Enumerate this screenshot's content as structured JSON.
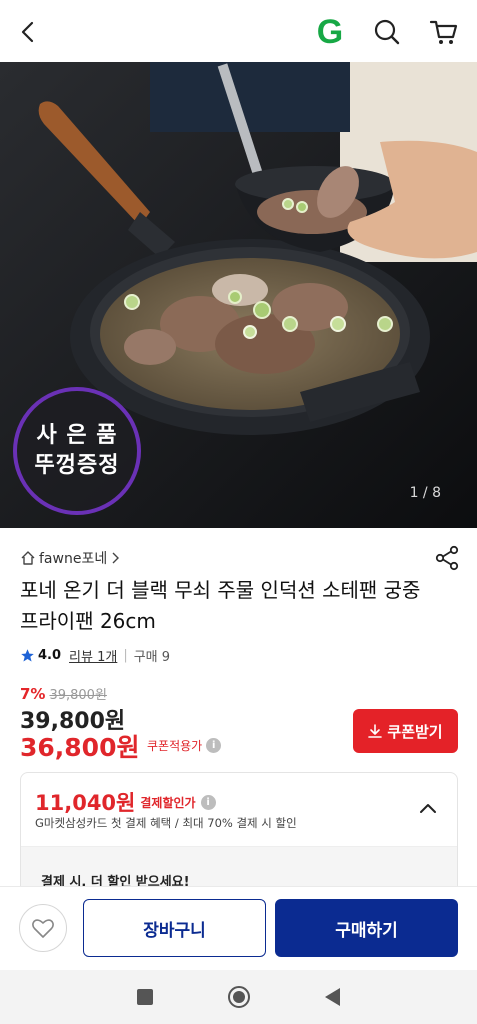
{
  "header": {
    "icons": [
      "back-arrow-icon",
      "gmarket-g-logo",
      "search-icon",
      "cart-icon"
    ],
    "logo_letter": "G",
    "logo_color": "#17a845"
  },
  "hero": {
    "badge_line1": "사 은 품",
    "badge_line2": "뚜껑증정",
    "badge_border_color": "#6a31b6",
    "pager": "1 / 8"
  },
  "product": {
    "brand": "fawne포네",
    "title": "포네 온기 더 블랙 무쇠 주물 인덕션 소테팬 궁중 프라이팬 26cm",
    "rating": "4.0",
    "review": "리뷰 1개",
    "purchase": "구매 9",
    "discount_pct": "7%",
    "original_small": "39,800원",
    "price": "39,800원",
    "coupon_price": "36,800원",
    "coupon_price_label": "쿠폰적용가",
    "coupon_button": "쿠폰받기"
  },
  "payment_discount": {
    "amount": "11,040원",
    "label": "결제할인가",
    "description": "G마켓삼성카드 첫 결제 혜택 / 최대 70% 결제 시 할인",
    "more_text": "결제 시, 더 할인 받으세요!"
  },
  "actions": {
    "cart": "장바구니",
    "buy": "구매하기",
    "primary_color": "#0b2b91",
    "accent_red": "#e0262b"
  }
}
